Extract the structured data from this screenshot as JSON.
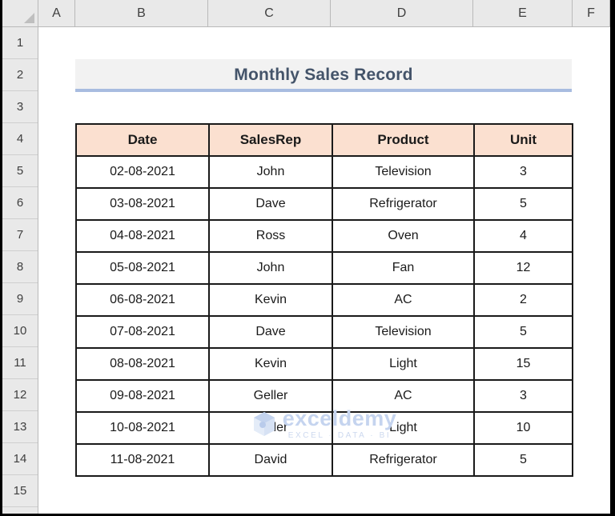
{
  "spreadsheet": {
    "column_headers": [
      "A",
      "B",
      "C",
      "D",
      "E",
      "F"
    ],
    "row_headers": [
      "1",
      "2",
      "3",
      "4",
      "5",
      "6",
      "7",
      "8",
      "9",
      "10",
      "11",
      "12",
      "13",
      "14",
      "15"
    ],
    "select_all_icon": "select-all-triangle"
  },
  "title": {
    "text": "Monthly Sales Record",
    "color": "#44546a",
    "banner_bg": "#f2f2f2",
    "underline_color": "#a8bce0"
  },
  "table": {
    "header_bg": "#fbe0d0",
    "border_color": "#1a1a1a",
    "columns": [
      "Date",
      "SalesRep",
      "Product",
      "Unit"
    ],
    "rows": [
      [
        "02-08-2021",
        "John",
        "Television",
        "3"
      ],
      [
        "03-08-2021",
        "Dave",
        "Refrigerator",
        "5"
      ],
      [
        "04-08-2021",
        "Ross",
        "Oven",
        "4"
      ],
      [
        "05-08-2021",
        "John",
        "Fan",
        "12"
      ],
      [
        "06-08-2021",
        "Kevin",
        "AC",
        "2"
      ],
      [
        "07-08-2021",
        "Dave",
        "Television",
        "5"
      ],
      [
        "08-08-2021",
        "Kevin",
        "Light",
        "15"
      ],
      [
        "09-08-2021",
        "Geller",
        "AC",
        "3"
      ],
      [
        "10-08-2021",
        "Geller",
        "Light",
        "10"
      ],
      [
        "11-08-2021",
        "David",
        "Refrigerator",
        "5"
      ]
    ]
  },
  "watermark": {
    "name": "exceldemy",
    "tagline": "EXCEL · DATA · BI",
    "color": "#c5d4ef"
  }
}
